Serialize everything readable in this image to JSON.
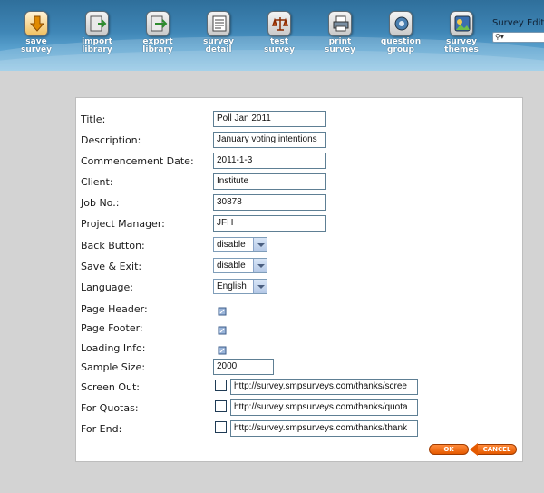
{
  "toolbar": {
    "items": [
      {
        "label_1": "save",
        "label_2": "survey",
        "icon": "save-survey-icon"
      },
      {
        "label_1": "import",
        "label_2": "library",
        "icon": "import-library-icon"
      },
      {
        "label_1": "export",
        "label_2": "library",
        "icon": "export-library-icon"
      },
      {
        "label_1": "survey",
        "label_2": "detail",
        "icon": "survey-detail-icon"
      },
      {
        "label_1": "test",
        "label_2": "survey",
        "icon": "test-survey-icon"
      },
      {
        "label_1": "print",
        "label_2": "survey",
        "icon": "print-survey-icon"
      },
      {
        "label_1": "question",
        "label_2": "group",
        "icon": "question-group-icon"
      },
      {
        "label_1": "survey",
        "label_2": "themes",
        "icon": "survey-themes-icon"
      }
    ],
    "editor_title": "Survey Editor",
    "search_icon": "search-icon"
  },
  "form": {
    "title_label": "Title:",
    "title_value": "Poll Jan 2011",
    "description_label": "Description:",
    "description_value": "January voting intentions",
    "commencement_label": "Commencement Date:",
    "commencement_value": "2011-1-3",
    "client_label": "Client:",
    "client_value": "Institute",
    "job_label": "Job No.:",
    "job_value": "30878",
    "pm_label": "Project Manager:",
    "pm_value": "JFH",
    "back_label": "Back Button:",
    "back_value": "disable",
    "save_exit_label": "Save & Exit:",
    "save_exit_value": "disable",
    "language_label": "Language:",
    "language_value": "English",
    "page_header_label": "Page Header:",
    "page_footer_label": "Page Footer:",
    "loading_info_label": "Loading Info:",
    "sample_label": "Sample Size:",
    "sample_value": "2000",
    "screen_out_label": "Screen Out:",
    "screen_out_value": "http://survey.smpsurveys.com/thanks/scree",
    "quotas_label": "For Quotas:",
    "quotas_value": "http://survey.smpsurveys.com/thanks/quota",
    "end_label": "For End:",
    "end_value": "http://survey.smpsurveys.com/thanks/thank"
  },
  "buttons": {
    "ok": "OK",
    "cancel": "CANCEL"
  },
  "colors": {
    "toolbar": "#3f86b6",
    "accent_orange": "#e55a00",
    "background": "#d3d3d3"
  }
}
